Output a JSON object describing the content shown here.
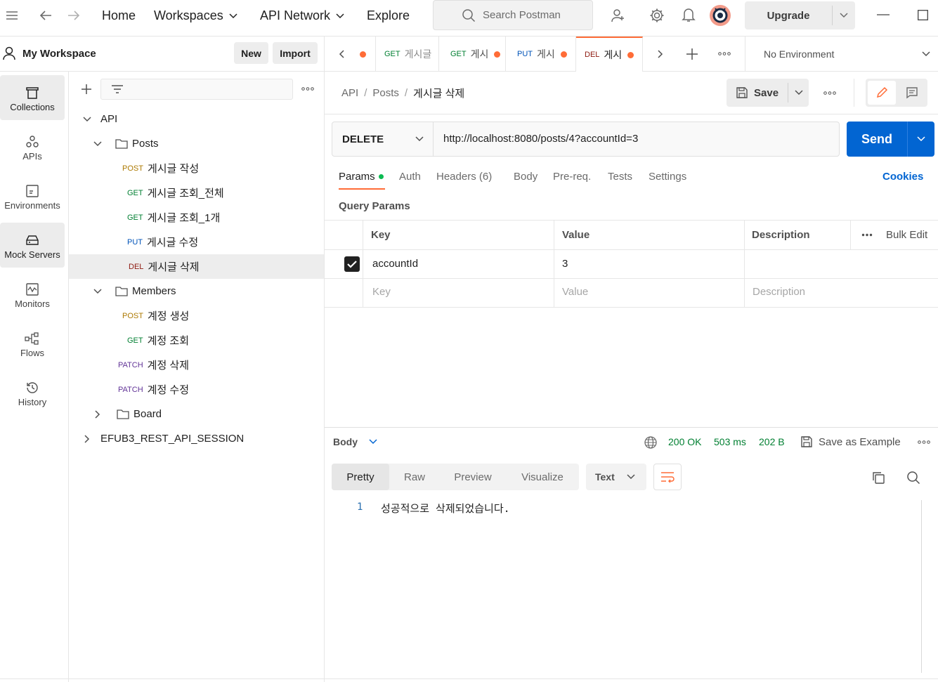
{
  "topbar": {
    "nav": [
      "Home",
      "Workspaces",
      "API Network",
      "Explore"
    ],
    "search_placeholder": "Search Postman",
    "upgrade_label": "Upgrade"
  },
  "workspace": {
    "title": "My Workspace",
    "new_label": "New",
    "import_label": "Import"
  },
  "rail": [
    {
      "label": "Collections",
      "icon": "collections-icon"
    },
    {
      "label": "APIs",
      "icon": "apis-icon"
    },
    {
      "label": "Environments",
      "icon": "environments-icon"
    },
    {
      "label": "Mock Servers",
      "icon": "mock-servers-icon"
    },
    {
      "label": "Monitors",
      "icon": "monitors-icon"
    },
    {
      "label": "Flows",
      "icon": "flows-icon"
    },
    {
      "label": "History",
      "icon": "history-icon"
    }
  ],
  "tree": {
    "root": "API",
    "folders": [
      {
        "name": "Posts"
      },
      {
        "name": "Members"
      },
      {
        "name": "Board"
      }
    ],
    "posts_requests": [
      {
        "method": "POST",
        "name": "게시글 작성"
      },
      {
        "method": "GET",
        "name": "게시글 조회_전체"
      },
      {
        "method": "GET",
        "name": "게시글 조회_1개"
      },
      {
        "method": "PUT",
        "name": "게시글 수정"
      },
      {
        "method": "DEL",
        "name": "게시글 삭제"
      }
    ],
    "members_requests": [
      {
        "method": "POST",
        "name": "계정 생성"
      },
      {
        "method": "GET",
        "name": "계정 조회"
      },
      {
        "method": "PATCH",
        "name": "계정 삭제"
      },
      {
        "method": "PATCH",
        "name": "계정 수정"
      }
    ],
    "other_collection": "EFUB3_REST_API_SESSION"
  },
  "tabs": [
    {
      "method": "GET",
      "name": "게시글"
    },
    {
      "method": "GET",
      "name": "게시"
    },
    {
      "method": "PUT",
      "name": "게시"
    },
    {
      "method": "DEL",
      "name": "게시"
    }
  ],
  "environment": "No Environment",
  "breadcrumb": {
    "a": "API",
    "b": "Posts",
    "c": "게시글 삭제"
  },
  "save_label": "Save",
  "request": {
    "method": "DELETE",
    "url": "http://localhost:8080/posts/4?accountId=3",
    "send_label": "Send"
  },
  "request_tabs": [
    "Params",
    "Auth",
    "Headers (6)",
    "Body",
    "Pre-req.",
    "Tests",
    "Settings"
  ],
  "cookies_label": "Cookies",
  "query_params": {
    "title": "Query Params",
    "headers": {
      "key": "Key",
      "value": "Value",
      "description": "Description",
      "bulk": "Bulk Edit"
    },
    "rows": [
      {
        "key": "accountId",
        "value": "3",
        "checked": true
      }
    ],
    "placeholders": {
      "key": "Key",
      "value": "Value",
      "description": "Description"
    }
  },
  "response": {
    "body_label": "Body",
    "status": "200 OK",
    "time": "503 ms",
    "size": "202 B",
    "save_example": "Save as Example",
    "view_tabs": [
      "Pretty",
      "Raw",
      "Preview",
      "Visualize"
    ],
    "format": "Text",
    "line_number": "1",
    "content": "성공적으로 삭제되었습니다."
  },
  "colors": {
    "accent": "#ff6c37",
    "send": "#0265d2",
    "status_ok": "#007f31"
  }
}
